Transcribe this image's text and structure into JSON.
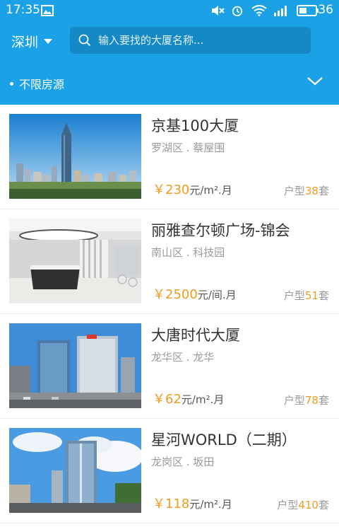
{
  "statusbar": {
    "time": "17:35",
    "battery": "36"
  },
  "header": {
    "city": "深圳",
    "search_placeholder": "输入要找的大厦名称...",
    "filter_label": "不限房源"
  },
  "buildings": [
    {
      "name": "京基100大厦",
      "location": "罗湖区 . 蔡屋围",
      "currency": "￥",
      "price": "230",
      "unit": "元/m².月",
      "rooms_label": "户型",
      "rooms_count": "38",
      "rooms_suffix": "套"
    },
    {
      "name": "丽雅查尔顿广场-锦会",
      "location": "南山区 . 科技园",
      "currency": "￥",
      "price": "2500",
      "unit": "元/间.月",
      "rooms_label": "户型",
      "rooms_count": "51",
      "rooms_suffix": "套"
    },
    {
      "name": "大唐时代大厦",
      "location": "龙华区 . 龙华",
      "currency": "￥",
      "price": "62",
      "unit": "元/m².月",
      "rooms_label": "户型",
      "rooms_count": "78",
      "rooms_suffix": "套"
    },
    {
      "name": "星河WORLD（二期）",
      "location": "龙岗区 . 坂田",
      "currency": "￥",
      "price": "118",
      "unit": "元/m².月",
      "rooms_label": "户型",
      "rooms_count": "410",
      "rooms_suffix": "套"
    }
  ]
}
